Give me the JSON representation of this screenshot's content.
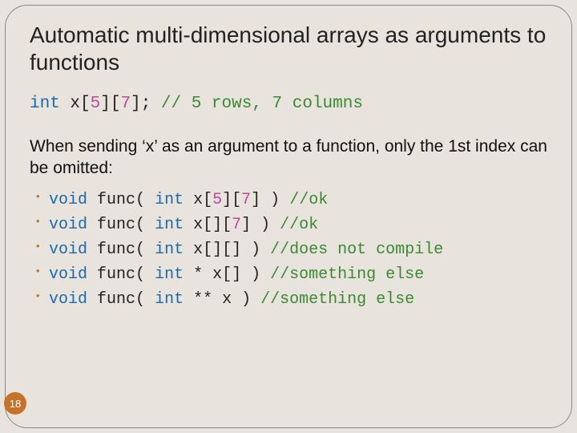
{
  "title": "Automatic multi-dimensional arrays as arguments to functions",
  "decl": {
    "kw": "int",
    "id": "x",
    "lb1": "[",
    "n1": "5",
    "rb1": "]",
    "lb2": "[",
    "n2": "7",
    "rb2": "]",
    "semi": ";",
    "cmt": "// 5 rows, 7 columns"
  },
  "body": "When sending ‘x’ as an argument to a function, only the 1st index can be omitted:",
  "items": [
    {
      "kw1": "void",
      "fn": "func(",
      "kw2": "int",
      "mid_pre": "x[",
      "n1": "5",
      "mid_mid": "][",
      "n2": "7",
      "mid_post": "] )",
      "cmt": "//ok"
    },
    {
      "kw1": "void",
      "fn": "func(",
      "kw2": "int",
      "mid_pre": "x[][",
      "n1": "",
      "mid_mid": "",
      "n2": "7",
      "mid_post": "] )",
      "cmt": "//ok"
    },
    {
      "kw1": "void",
      "fn": "func(",
      "kw2": "int",
      "mid_pre": "x[][] )",
      "n1": "",
      "mid_mid": "",
      "n2": "",
      "mid_post": "",
      "cmt": "//does not compile"
    },
    {
      "kw1": "void",
      "fn": "func(",
      "kw2": "int",
      "mid_pre": "* x[] )",
      "n1": "",
      "mid_mid": "",
      "n2": "",
      "mid_post": "",
      "cmt": "//something else"
    },
    {
      "kw1": "void",
      "fn": "func(",
      "kw2": "int",
      "mid_pre": "** x )",
      "n1": "",
      "mid_mid": "",
      "n2": "",
      "mid_post": "",
      "cmt": "//something else"
    }
  ],
  "page": "18"
}
